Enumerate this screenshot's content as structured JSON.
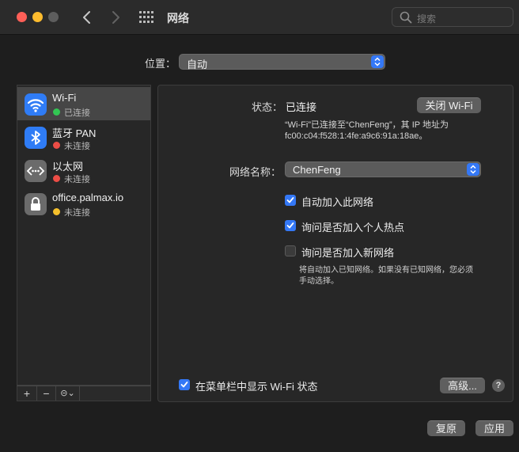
{
  "window": {
    "title": "网络",
    "search_placeholder": "搜索"
  },
  "location": {
    "label": "位置：",
    "value": "自动"
  },
  "services": [
    {
      "name": "Wi-Fi",
      "status": "已连接",
      "status_color": "#32c653",
      "icon": "wifi-icon",
      "selected": true
    },
    {
      "name": "蓝牙 PAN",
      "status": "未连接",
      "status_color": "#ec4d46",
      "icon": "bluetooth-icon",
      "selected": false
    },
    {
      "name": "以太网",
      "status": "未连接",
      "status_color": "#ec4d46",
      "icon": "ethernet-icon",
      "selected": false
    },
    {
      "name": "office.palmax.io",
      "status": "未连接",
      "status_color": "#f5c02c",
      "icon": "vpn-lock-icon",
      "selected": false
    }
  ],
  "sidebar_toolbar": {
    "add": "+",
    "remove": "−",
    "action": "⊝⌄"
  },
  "detail": {
    "status_label": "状态：",
    "status_value": "已连接",
    "turn_off_button": "关闭 Wi-Fi",
    "status_desc_line1": "“Wi-Fi”已连接至“ChenFeng”，其 IP 地址为",
    "status_desc_line2": "fc00:c04:f528:1:4fe:a9c6:91a:18ae。",
    "network_name_label": "网络名称：",
    "network_name_value": "ChenFeng",
    "options": [
      {
        "label": "自动加入此网络",
        "checked": true
      },
      {
        "label": "询问是否加入个人热点",
        "checked": true
      },
      {
        "label": "询问是否加入新网络",
        "checked": false
      }
    ],
    "new_network_note_line1": "将自动加入已知网络。如果没有已知网络，您必须",
    "new_network_note_line2": "手动选择。",
    "show_in_menubar_label": "在菜单栏中显示 Wi-Fi 状态",
    "show_in_menubar_checked": true,
    "advanced_button": "高级...",
    "help_button": "?"
  },
  "footer": {
    "revert_button": "复原",
    "apply_button": "应用"
  },
  "colors": {
    "accent": "#3478f6",
    "connected": "#32c653",
    "disconnected": "#ec4d46",
    "vpn": "#f5c02c"
  }
}
